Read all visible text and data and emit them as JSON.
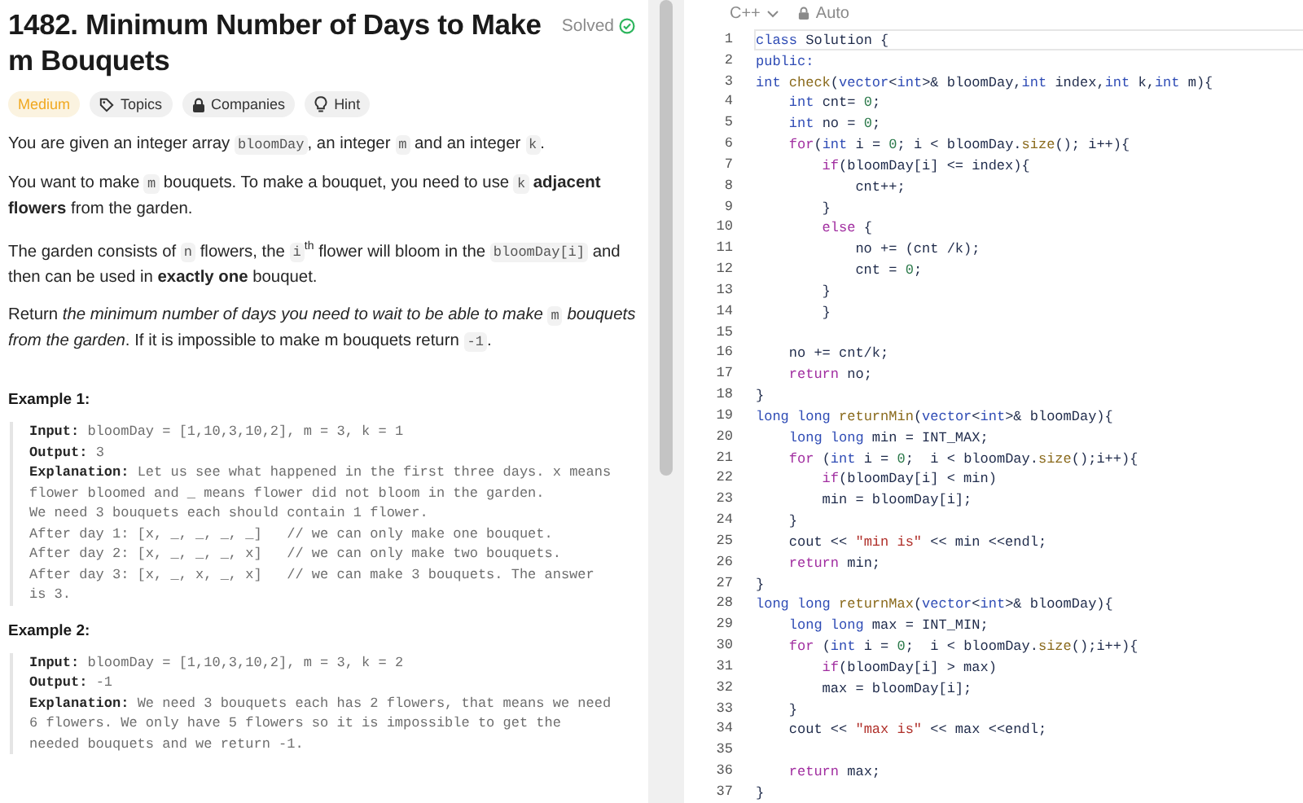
{
  "problem": {
    "title": "1482. Minimum Number of Days to Make m Bouquets",
    "status": "Solved",
    "tags": [
      {
        "kind": "difficulty",
        "label": "Medium"
      },
      {
        "kind": "topics",
        "label": "Topics"
      },
      {
        "kind": "companies",
        "label": "Companies"
      },
      {
        "kind": "hint",
        "label": "Hint"
      }
    ],
    "paragraphs": [
      [
        {
          "kind": "text",
          "text": "You are given an integer array "
        },
        {
          "kind": "code",
          "text": "bloomDay"
        },
        {
          "kind": "text",
          "text": ", an integer "
        },
        {
          "kind": "code",
          "text": "m"
        },
        {
          "kind": "text",
          "text": " and an integer "
        },
        {
          "kind": "code",
          "text": "k"
        },
        {
          "kind": "text",
          "text": "."
        }
      ],
      [
        {
          "kind": "text",
          "text": "You want to make "
        },
        {
          "kind": "code",
          "text": "m"
        },
        {
          "kind": "text",
          "text": " bouquets. To make a bouquet, you need to use "
        },
        {
          "kind": "code",
          "text": "k"
        },
        {
          "kind": "text",
          "text": " **adjacent flowers** from the garden."
        }
      ],
      [
        {
          "kind": "text",
          "text": "The garden consists of "
        },
        {
          "kind": "code",
          "text": "n"
        },
        {
          "kind": "text",
          "text": " flowers, the "
        },
        {
          "kind": "code",
          "text": "i"
        },
        {
          "kind": "text",
          "text": "$^{th}$ flower will bloom in the "
        },
        {
          "kind": "code",
          "text": "bloomDay[i]"
        },
        {
          "kind": "text",
          "text": " and then can be used in **exactly one** bouquet."
        }
      ],
      [
        {
          "kind": "text",
          "text": "Return *the minimum number of days you need to wait to be able to make* "
        },
        {
          "kind": "code",
          "text": "m"
        },
        {
          "kind": "text",
          "text": " *bouquets from the garden*. If it is impossible to make m bouquets return "
        },
        {
          "kind": "code",
          "text": "-1"
        },
        {
          "kind": "text",
          "text": "."
        }
      ]
    ],
    "examples": [
      {
        "heading": "Example 1:",
        "body": "**Input:** bloomDay = [1,10,3,10,2], m = 3, k = 1\n**Output:** 3\n**Explanation:** Let us see what happened in the first three days. x means\nflower bloomed and _ means flower did not bloom in the garden.\nWe need 3 bouquets each should contain 1 flower.\nAfter day 1: [x, _, _, _, _]   // we can only make one bouquet.\nAfter day 2: [x, _, _, _, x]   // we can only make two bouquets.\nAfter day 3: [x, _, x, _, x]   // we can make 3 bouquets. The answer\nis 3."
      },
      {
        "heading": "Example 2:",
        "body": "**Input:** bloomDay = [1,10,3,10,2], m = 3, k = 2\n**Output:** -1\n**Explanation:** We need 3 bouquets each has 2 flowers, that means we need\n6 flowers. We only have 5 flowers so it is impossible to get the\nneeded bouquets and we return -1."
      }
    ]
  },
  "editor": {
    "language": "C++",
    "mode": "Auto",
    "lines": [
      {
        "number": "1",
        "current": true,
        "tokens": [
          {
            "kind": "type",
            "text": "class"
          },
          {
            "kind": "plain",
            "text": " Solution {"
          }
        ]
      },
      {
        "number": "2",
        "current": false,
        "tokens": [
          {
            "kind": "type",
            "text": "public:"
          }
        ]
      },
      {
        "number": "3",
        "current": false,
        "tokens": [
          {
            "kind": "type",
            "text": "int "
          },
          {
            "kind": "func",
            "text": "check"
          },
          {
            "kind": "plain",
            "text": "("
          },
          {
            "kind": "type",
            "text": "vector"
          },
          {
            "kind": "plain",
            "text": "<"
          },
          {
            "kind": "type",
            "text": "int"
          },
          {
            "kind": "plain",
            "text": ">& bloomDay,"
          },
          {
            "kind": "type",
            "text": "int"
          },
          {
            "kind": "plain",
            "text": " index,"
          },
          {
            "kind": "type",
            "text": "int"
          },
          {
            "kind": "plain",
            "text": " k,"
          },
          {
            "kind": "type",
            "text": "int"
          },
          {
            "kind": "plain",
            "text": " m){"
          }
        ]
      },
      {
        "number": "4",
        "current": false,
        "tokens": [
          {
            "kind": "type",
            "text": "    int"
          },
          {
            "kind": "plain",
            "text": " cnt= "
          },
          {
            "kind": "num",
            "text": "0"
          },
          {
            "kind": "plain",
            "text": ";"
          }
        ]
      },
      {
        "number": "5",
        "current": false,
        "tokens": [
          {
            "kind": "type",
            "text": "    int"
          },
          {
            "kind": "plain",
            "text": " no = "
          },
          {
            "kind": "num",
            "text": "0"
          },
          {
            "kind": "plain",
            "text": ";"
          }
        ]
      },
      {
        "number": "6",
        "current": false,
        "tokens": [
          {
            "kind": "control",
            "text": "    for"
          },
          {
            "kind": "plain",
            "text": "("
          },
          {
            "kind": "type",
            "text": "int"
          },
          {
            "kind": "plain",
            "text": " i = "
          },
          {
            "kind": "num",
            "text": "0"
          },
          {
            "kind": "plain",
            "text": "; i < bloomDay."
          },
          {
            "kind": "func",
            "text": "size"
          },
          {
            "kind": "plain",
            "text": "(); i++){"
          }
        ]
      },
      {
        "number": "7",
        "current": false,
        "tokens": [
          {
            "kind": "control",
            "text": "        if"
          },
          {
            "kind": "plain",
            "text": "(bloomDay[i] <= index){"
          }
        ]
      },
      {
        "number": "8",
        "current": false,
        "tokens": [
          {
            "kind": "plain",
            "text": "            cnt++;"
          }
        ]
      },
      {
        "number": "9",
        "current": false,
        "tokens": [
          {
            "kind": "plain",
            "text": "        }"
          }
        ]
      },
      {
        "number": "10",
        "current": false,
        "tokens": [
          {
            "kind": "control",
            "text": "        else"
          },
          {
            "kind": "plain",
            "text": " {"
          }
        ]
      },
      {
        "number": "11",
        "current": false,
        "tokens": [
          {
            "kind": "plain",
            "text": "            no += (cnt /k);"
          }
        ]
      },
      {
        "number": "12",
        "current": false,
        "tokens": [
          {
            "kind": "plain",
            "text": "            cnt = "
          },
          {
            "kind": "num",
            "text": "0"
          },
          {
            "kind": "plain",
            "text": ";"
          }
        ]
      },
      {
        "number": "13",
        "current": false,
        "tokens": [
          {
            "kind": "plain",
            "text": "        }"
          }
        ]
      },
      {
        "number": "14",
        "current": false,
        "tokens": [
          {
            "kind": "plain",
            "text": "        }"
          }
        ]
      },
      {
        "number": "15",
        "current": false
      },
      {
        "number": "16",
        "current": false,
        "tokens": [
          {
            "kind": "plain",
            "text": "    no += cnt/k;"
          }
        ]
      },
      {
        "number": "17",
        "current": false,
        "tokens": [
          {
            "kind": "control",
            "text": "    return"
          },
          {
            "kind": "plain",
            "text": " no;"
          }
        ]
      },
      {
        "number": "18",
        "current": false,
        "tokens": [
          {
            "kind": "plain",
            "text": "}"
          }
        ]
      },
      {
        "number": "19",
        "current": false,
        "tokens": [
          {
            "kind": "type",
            "text": "long long "
          },
          {
            "kind": "func",
            "text": "returnMin"
          },
          {
            "kind": "plain",
            "text": "("
          },
          {
            "kind": "type",
            "text": "vector"
          },
          {
            "kind": "plain",
            "text": "<"
          },
          {
            "kind": "type",
            "text": "int"
          },
          {
            "kind": "plain",
            "text": ">& bloomDay){"
          }
        ]
      },
      {
        "number": "20",
        "current": false,
        "tokens": [
          {
            "kind": "type",
            "text": "    long long"
          },
          {
            "kind": "plain",
            "text": " min = INT_MAX;"
          }
        ]
      },
      {
        "number": "21",
        "current": false,
        "tokens": [
          {
            "kind": "control",
            "text": "    for"
          },
          {
            "kind": "plain",
            "text": " ("
          },
          {
            "kind": "type",
            "text": "int"
          },
          {
            "kind": "plain",
            "text": " i = "
          },
          {
            "kind": "num",
            "text": "0"
          },
          {
            "kind": "plain",
            "text": ";  i < bloomDay."
          },
          {
            "kind": "func",
            "text": "size"
          },
          {
            "kind": "plain",
            "text": "();i++){"
          }
        ]
      },
      {
        "number": "22",
        "current": false,
        "tokens": [
          {
            "kind": "control",
            "text": "        if"
          },
          {
            "kind": "plain",
            "text": "(bloomDay[i] < min)"
          }
        ]
      },
      {
        "number": "23",
        "current": false,
        "tokens": [
          {
            "kind": "plain",
            "text": "        min = bloomDay[i];"
          }
        ]
      },
      {
        "number": "24",
        "current": false,
        "tokens": [
          {
            "kind": "plain",
            "text": "    }"
          }
        ]
      },
      {
        "number": "25",
        "current": false,
        "tokens": [
          {
            "kind": "plain",
            "text": "    cout << "
          },
          {
            "kind": "str",
            "text": "\"min is\""
          },
          {
            "kind": "plain",
            "text": " << min <<endl;"
          }
        ]
      },
      {
        "number": "26",
        "current": false,
        "tokens": [
          {
            "kind": "control",
            "text": "    return"
          },
          {
            "kind": "plain",
            "text": " min;"
          }
        ]
      },
      {
        "number": "27",
        "current": false,
        "tokens": [
          {
            "kind": "plain",
            "text": "}"
          }
        ]
      },
      {
        "number": "28",
        "current": false,
        "tokens": [
          {
            "kind": "type",
            "text": "long long "
          },
          {
            "kind": "func",
            "text": "returnMax"
          },
          {
            "kind": "plain",
            "text": "("
          },
          {
            "kind": "type",
            "text": "vector"
          },
          {
            "kind": "plain",
            "text": "<"
          },
          {
            "kind": "type",
            "text": "int"
          },
          {
            "kind": "plain",
            "text": ">& bloomDay){"
          }
        ]
      },
      {
        "number": "29",
        "current": false,
        "tokens": [
          {
            "kind": "type",
            "text": "    long long"
          },
          {
            "kind": "plain",
            "text": " max = INT_MIN;"
          }
        ]
      },
      {
        "number": "30",
        "current": false,
        "tokens": [
          {
            "kind": "control",
            "text": "    for"
          },
          {
            "kind": "plain",
            "text": " ("
          },
          {
            "kind": "type",
            "text": "int"
          },
          {
            "kind": "plain",
            "text": " i = "
          },
          {
            "kind": "num",
            "text": "0"
          },
          {
            "kind": "plain",
            "text": ";  i < bloomDay."
          },
          {
            "kind": "func",
            "text": "size"
          },
          {
            "kind": "plain",
            "text": "();i++){"
          }
        ]
      },
      {
        "number": "31",
        "current": false,
        "tokens": [
          {
            "kind": "control",
            "text": "        if"
          },
          {
            "kind": "plain",
            "text": "(bloomDay[i] > max)"
          }
        ]
      },
      {
        "number": "32",
        "current": false,
        "tokens": [
          {
            "kind": "plain",
            "text": "        max = bloomDay[i];"
          }
        ]
      },
      {
        "number": "33",
        "current": false,
        "tokens": [
          {
            "kind": "plain",
            "text": "    }"
          }
        ]
      },
      {
        "number": "34",
        "current": false,
        "tokens": [
          {
            "kind": "plain",
            "text": "    cout << "
          },
          {
            "kind": "str",
            "text": "\"max is\""
          },
          {
            "kind": "plain",
            "text": " << max <<endl;"
          }
        ]
      },
      {
        "number": "35",
        "current": false
      },
      {
        "number": "36",
        "current": false,
        "tokens": [
          {
            "kind": "control",
            "text": "    return"
          },
          {
            "kind": "plain",
            "text": " max;"
          }
        ]
      },
      {
        "number": "37",
        "current": false,
        "tokens": [
          {
            "kind": "plain",
            "text": "}"
          }
        ]
      }
    ]
  }
}
